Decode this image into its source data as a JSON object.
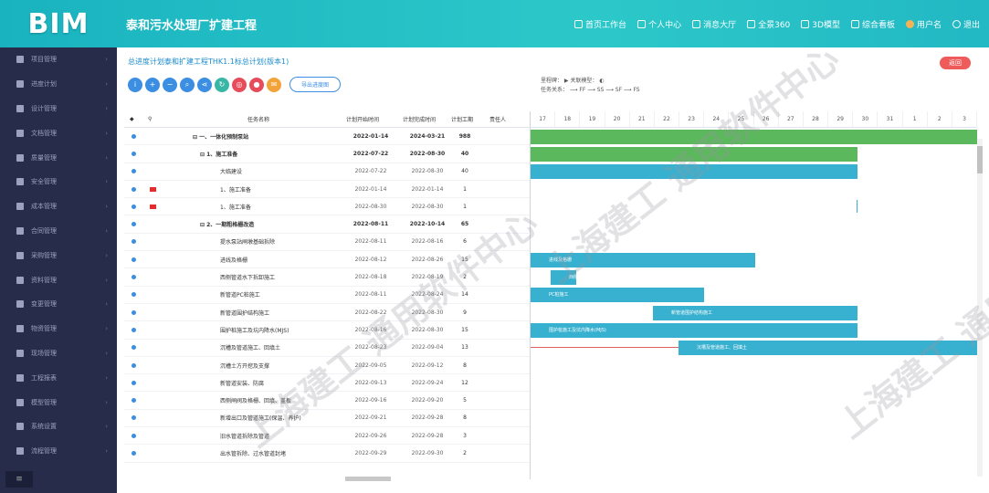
{
  "app": {
    "logo": "BIM",
    "project_title": "泰和污水处理厂扩建工程"
  },
  "header_nav": [
    "首页工作台",
    "个人中心",
    "消息大厅",
    "全景360",
    "3D模型",
    "综合看板",
    "用户名",
    "退出"
  ],
  "sidebar": {
    "items": [
      "项目管理",
      "进度计划",
      "设计管理",
      "文档管理",
      "质量管理",
      "安全管理",
      "成本管理",
      "合同管理",
      "采购管理",
      "资料管理",
      "变更管理",
      "物资管理",
      "现场管理",
      "工程报表",
      "模型管理",
      "系统设置",
      "流程管理"
    ],
    "bottom": "≡"
  },
  "page": {
    "title": "总进度计划泰和扩建工程THK1.1标总计划(版本1)",
    "back_label": "返回",
    "toolbar_button": "导出进度图"
  },
  "legend": {
    "line1": "里程碑：  ▶     关联模型：  ◐",
    "line2": "任务关系：  ⟶ FF ⟶ SS ⟶ SF ⟶ FS"
  },
  "columns": {
    "no": "◆",
    "flag": "⚲",
    "name": "任务名称",
    "start": "计划开始时间",
    "end": "计划完成时间",
    "duration": "计划工期",
    "owner": "责任人"
  },
  "timeline": [
    "17",
    "18",
    "19",
    "20",
    "21",
    "22",
    "23",
    "24",
    "25",
    "26",
    "27",
    "28",
    "29",
    "30",
    "31",
    "1",
    "2",
    "3"
  ],
  "rows": [
    {
      "name": "⊟ 一、一体化预制泵站",
      "start": "2022-01-14",
      "end": "2024-03-21",
      "dur": "988"
    },
    {
      "name": "⊟ 1、施工准备",
      "start": "2022-07-22",
      "end": "2022-08-30",
      "dur": "40"
    },
    {
      "name": "大临建设",
      "start": "2022-07-22",
      "end": "2022-08-30",
      "dur": "40"
    },
    {
      "name": "1、施工准备",
      "start": "2022-01-14",
      "end": "2022-01-14",
      "dur": "1"
    },
    {
      "name": "1、施工准备",
      "start": "2022-08-30",
      "end": "2022-08-30",
      "dur": "1"
    },
    {
      "name": "⊟ 2、一期粗格栅改造",
      "start": "2022-08-11",
      "end": "2022-10-14",
      "dur": "65"
    },
    {
      "name": "提水泵站闸墩基础拆除",
      "start": "2022-08-11",
      "end": "2022-08-16",
      "dur": "6"
    },
    {
      "name": "进线及格栅",
      "start": "2022-08-12",
      "end": "2022-08-26",
      "dur": "15"
    },
    {
      "name": "西侧管道水下拆卸施工",
      "start": "2022-08-18",
      "end": "2022-08-19",
      "dur": "2"
    },
    {
      "name": "新管道PC桩施工",
      "start": "2022-08-11",
      "end": "2022-08-24",
      "dur": "14"
    },
    {
      "name": "新管道围护结构施工",
      "start": "2022-08-22",
      "end": "2022-08-30",
      "dur": "9"
    },
    {
      "name": "围护桩施工及坑内降水(MJS)",
      "start": "2022-08-16",
      "end": "2022-08-30",
      "dur": "15"
    },
    {
      "name": "沉槽及管道施工、回填土",
      "start": "2022-08-23",
      "end": "2022-09-04",
      "dur": "13"
    },
    {
      "name": "沉槽土方开挖及支撑",
      "start": "2022-09-05",
      "end": "2022-09-12",
      "dur": "8"
    },
    {
      "name": "新管道安装、防腐",
      "start": "2022-09-13",
      "end": "2022-09-24",
      "dur": "12"
    },
    {
      "name": "西侧闸阀及格栅、回填、盖板",
      "start": "2022-09-16",
      "end": "2022-09-20",
      "dur": "5"
    },
    {
      "name": "新增出口及管道施工(保温、养护)",
      "start": "2022-09-21",
      "end": "2022-09-28",
      "dur": "8"
    },
    {
      "name": "旧水管道拆除及管道",
      "start": "2022-09-26",
      "end": "2022-09-28",
      "dur": "3"
    },
    {
      "name": "出水管拆除、过水管道封堵",
      "start": "2022-09-29",
      "end": "2022-09-30",
      "dur": "2"
    }
  ],
  "bars": [
    {
      "row": 0,
      "type": "g",
      "label": ""
    },
    {
      "row": 1,
      "type": "g",
      "label": ""
    },
    {
      "row": 2,
      "type": "t",
      "label": ""
    },
    {
      "row": 7,
      "type": "t",
      "label": "进线及格栅"
    },
    {
      "row": 8,
      "type": "t",
      "label": "西侧管道"
    },
    {
      "row": 9,
      "type": "t",
      "label": "PC桩施工"
    },
    {
      "row": 10,
      "type": "t",
      "label": "新管道围护结构施工"
    },
    {
      "row": 11,
      "type": "t",
      "label": "围护桩施工及坑内降水(MJS)"
    },
    {
      "row": 12,
      "type": "t",
      "label": "沉槽及管道施工、回填土"
    }
  ],
  "watermark": "上海建工 通用软件中心",
  "colors": {
    "header": "#22bcc5",
    "sidebar": "#262c49",
    "green_bar": "#5cb85c",
    "teal_bar": "#38b0cf",
    "accent": "#3b8ee2",
    "back": "#ef5a5a"
  }
}
